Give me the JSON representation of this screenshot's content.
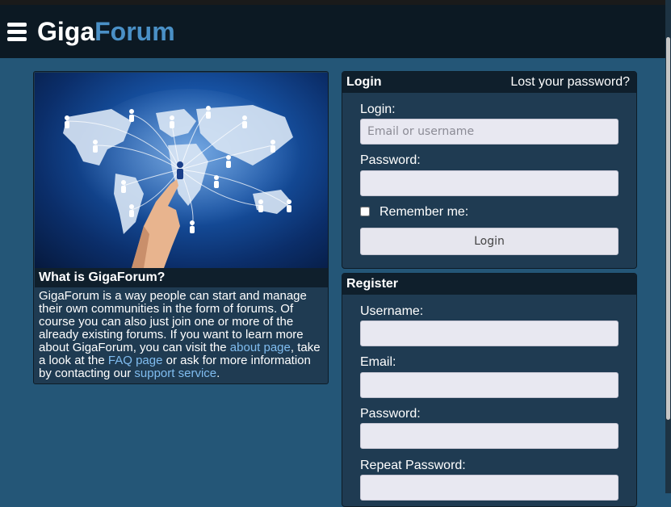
{
  "header": {
    "logo_part1": "Giga",
    "logo_part2": "Forum"
  },
  "intro": {
    "title": "What is GigaForum?",
    "text_1": "GigaForum is a way people can start and manage their own communities in the form of forums. Of course you can also just join one or more of the already existing forums. If you want to learn more about GigaForum, you can visit the ",
    "about_link": "about page",
    "text_2": ", take a look at the ",
    "faq_link": "FAQ page",
    "text_3": " or ask for more information by contacting our ",
    "support_link": "support service",
    "text_4": "."
  },
  "login": {
    "title": "Login",
    "lost_password": "Lost your password?",
    "login_label": "Login:",
    "login_placeholder": "Email or username",
    "password_label": "Password:",
    "remember_label": "Remember me:",
    "submit": "Login"
  },
  "register": {
    "title": "Register",
    "username_label": "Username:",
    "email_label": "Email:",
    "password_label": "Password:",
    "repeat_password_label": "Repeat Password:"
  },
  "colors": {
    "background": "#245677",
    "header": "#0c1923",
    "logo_accent": "#4a90c6",
    "link": "#80bdf0"
  }
}
